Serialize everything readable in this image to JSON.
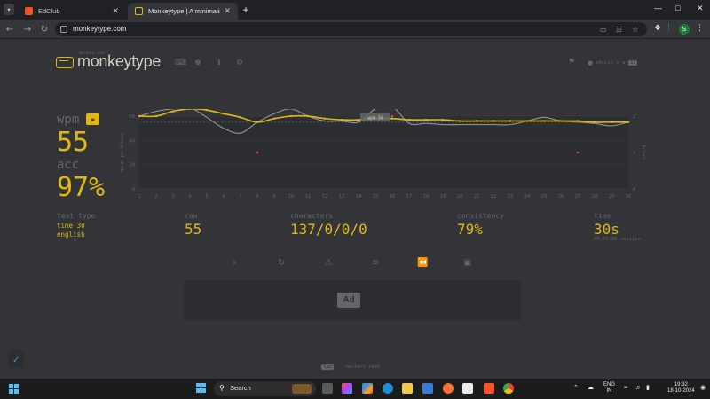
{
  "browser": {
    "tabs": [
      {
        "title": "EdClub",
        "active": false,
        "favicon_color": "#f4511e"
      },
      {
        "title": "Monkeytype | A minimalistic, c",
        "active": true,
        "favicon_color": "#e2b714"
      }
    ],
    "new_tab": "+",
    "url": "monkeytype.com",
    "profile_initial": "S",
    "window_controls": [
      "—",
      "□",
      "✕"
    ]
  },
  "site": {
    "logo_small": "monkey see",
    "logo_text": "monkeytype",
    "username": "sharil_v_a",
    "user_level": "13"
  },
  "results": {
    "wpm_label": "wpm",
    "wpm": "55",
    "acc_label": "acc",
    "acc": "97%",
    "test_type_label": "test type",
    "test_type_lines": [
      "time 30",
      "english"
    ],
    "raw_label": "raw",
    "raw": "55",
    "characters_label": "characters",
    "characters": "137/0/0/0",
    "consistency_label": "consistency",
    "consistency": "79%",
    "time_label": "time",
    "time": "30s",
    "session": "00:01:08 session"
  },
  "chart_data": {
    "type": "line",
    "x": [
      1,
      2,
      3,
      4,
      5,
      6,
      7,
      8,
      9,
      10,
      11,
      12,
      13,
      14,
      15,
      16,
      17,
      18,
      19,
      20,
      21,
      22,
      23,
      24,
      25,
      26,
      27,
      28,
      29,
      30
    ],
    "ylabel": "Words per Minute",
    "y2label": "Errors",
    "ylim": [
      0,
      60
    ],
    "y2lim": [
      0,
      2
    ],
    "yticks": [
      0,
      20,
      40,
      60
    ],
    "y2ticks": [
      0,
      1,
      2
    ],
    "tooltip": "wpm 56",
    "series": [
      {
        "role": "wpm",
        "color": "#e2b714",
        "values": [
          60,
          60,
          64,
          66,
          65,
          62,
          59,
          55,
          58,
          60,
          60,
          58,
          57,
          57,
          58,
          58,
          57,
          57,
          57,
          56,
          56,
          56,
          56,
          56,
          56,
          56,
          56,
          55,
          55,
          55
        ]
      },
      {
        "role": "raw",
        "color": "#8b8d90",
        "values": [
          60,
          64,
          66,
          67,
          59,
          50,
          46,
          55,
          62,
          66,
          60,
          56,
          56,
          55,
          66,
          68,
          54,
          54,
          53,
          53,
          53,
          53,
          53,
          56,
          59,
          56,
          55,
          54,
          52,
          55
        ]
      },
      {
        "role": "errors",
        "color": "#ca4754",
        "points": [
          {
            "x": 8,
            "y": 1
          },
          {
            "x": 16,
            "y": 2
          },
          {
            "x": 27,
            "y": 1
          }
        ]
      }
    ]
  },
  "actions": [
    "next test",
    "restart test",
    "report",
    "words history",
    "replay",
    "screenshot"
  ],
  "ad_label": "Ad",
  "footer_hint": {
    "key": "tab",
    "text": "- restart test"
  },
  "taskbar": {
    "search": "Search",
    "lang": [
      "ENG",
      "IN"
    ],
    "time": "19:32",
    "date": "18-10-2024"
  }
}
